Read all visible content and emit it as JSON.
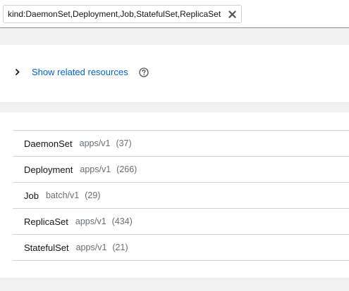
{
  "filter": {
    "chip_label": "kind:DaemonSet,Deployment,Job,StatefulSet,ReplicaSet",
    "close_icon": "close-icon"
  },
  "related": {
    "toggle_icon": "chevron-right-icon",
    "link_label": "Show related resources",
    "help_icon": "question-circle-icon"
  },
  "resources": [
    {
      "kind": "DaemonSet",
      "api": "apps/v1",
      "count": "(37)"
    },
    {
      "kind": "Deployment",
      "api": "apps/v1",
      "count": "(266)"
    },
    {
      "kind": "Job",
      "api": "batch/v1",
      "count": "(29)"
    },
    {
      "kind": "ReplicaSet",
      "api": "apps/v1",
      "count": "(434)"
    },
    {
      "kind": "StatefulSet",
      "api": "apps/v1",
      "count": "(21)"
    }
  ],
  "colors": {
    "link": "#0066cc",
    "muted_text": "#6a6e73",
    "page_bg": "#f0f0f0",
    "divider": "#d2d2d2"
  }
}
